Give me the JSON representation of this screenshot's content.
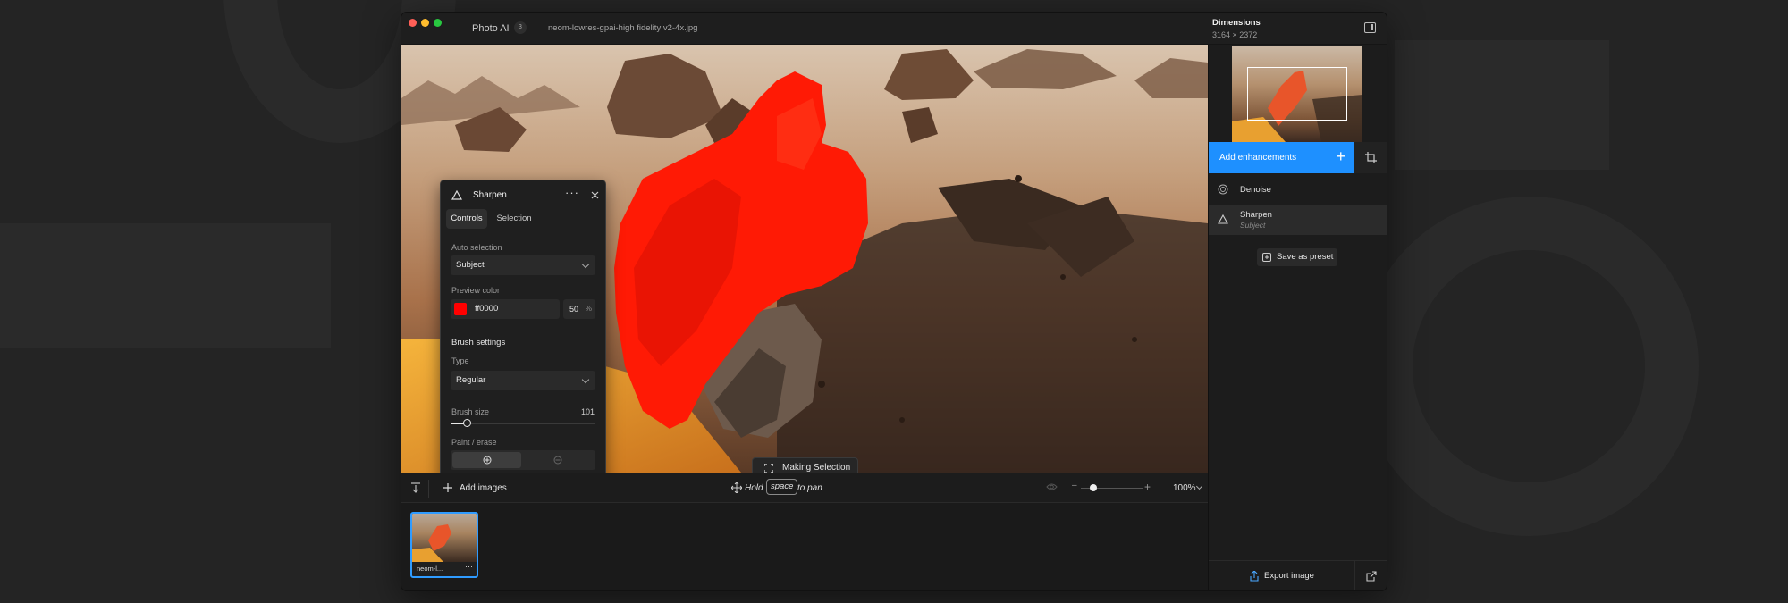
{
  "window": {
    "app_name": "Photo AI",
    "badge_count": "3",
    "file_name": "neom-lowres-gpai-high fidelity v2-4x.jpg",
    "dimensions_title": "Dimensions",
    "dimensions_value": "3164 × 2372"
  },
  "tool_panel": {
    "title": "Sharpen",
    "tabs": [
      {
        "label": "Controls",
        "active": true
      },
      {
        "label": "Selection",
        "active": false
      }
    ],
    "auto_selection_label": "Auto selection",
    "auto_selection_value": "Subject",
    "preview_color_label": "Preview color",
    "preview_color_hex": "ff0000",
    "preview_opacity": "50",
    "preview_opacity_unit": "%",
    "brush_settings_label": "Brush settings",
    "type_label": "Type",
    "type_value": "Regular",
    "brush_size_label": "Brush size",
    "brush_size_value": "101",
    "brush_size_fraction": 0.12,
    "paint_erase_label": "Paint / erase"
  },
  "canvas": {
    "making_selection_label": "Making Selection"
  },
  "bottom_bar": {
    "add_images_label": "Add images",
    "hold_label": "Hold",
    "space_key": "space",
    "to_pan_label": "to pan",
    "zoom_value": "100%",
    "zoom_fraction": 0.2
  },
  "filmstrip": {
    "items": [
      {
        "label": "neom-l..."
      }
    ]
  },
  "sidebar": {
    "add_enhancements_label": "Add enhancements",
    "enhancements": [
      {
        "name": "Denoise",
        "sub": ""
      },
      {
        "name": "Sharpen",
        "sub": "Subject"
      }
    ],
    "save_preset_label": "Save as preset",
    "export_label": "Export image"
  },
  "colors": {
    "accent": "#1e90ff",
    "selection_overlay": "#ff0000",
    "traffic_close": "#ff5f57",
    "traffic_min": "#febc2e",
    "traffic_max": "#28c840"
  }
}
